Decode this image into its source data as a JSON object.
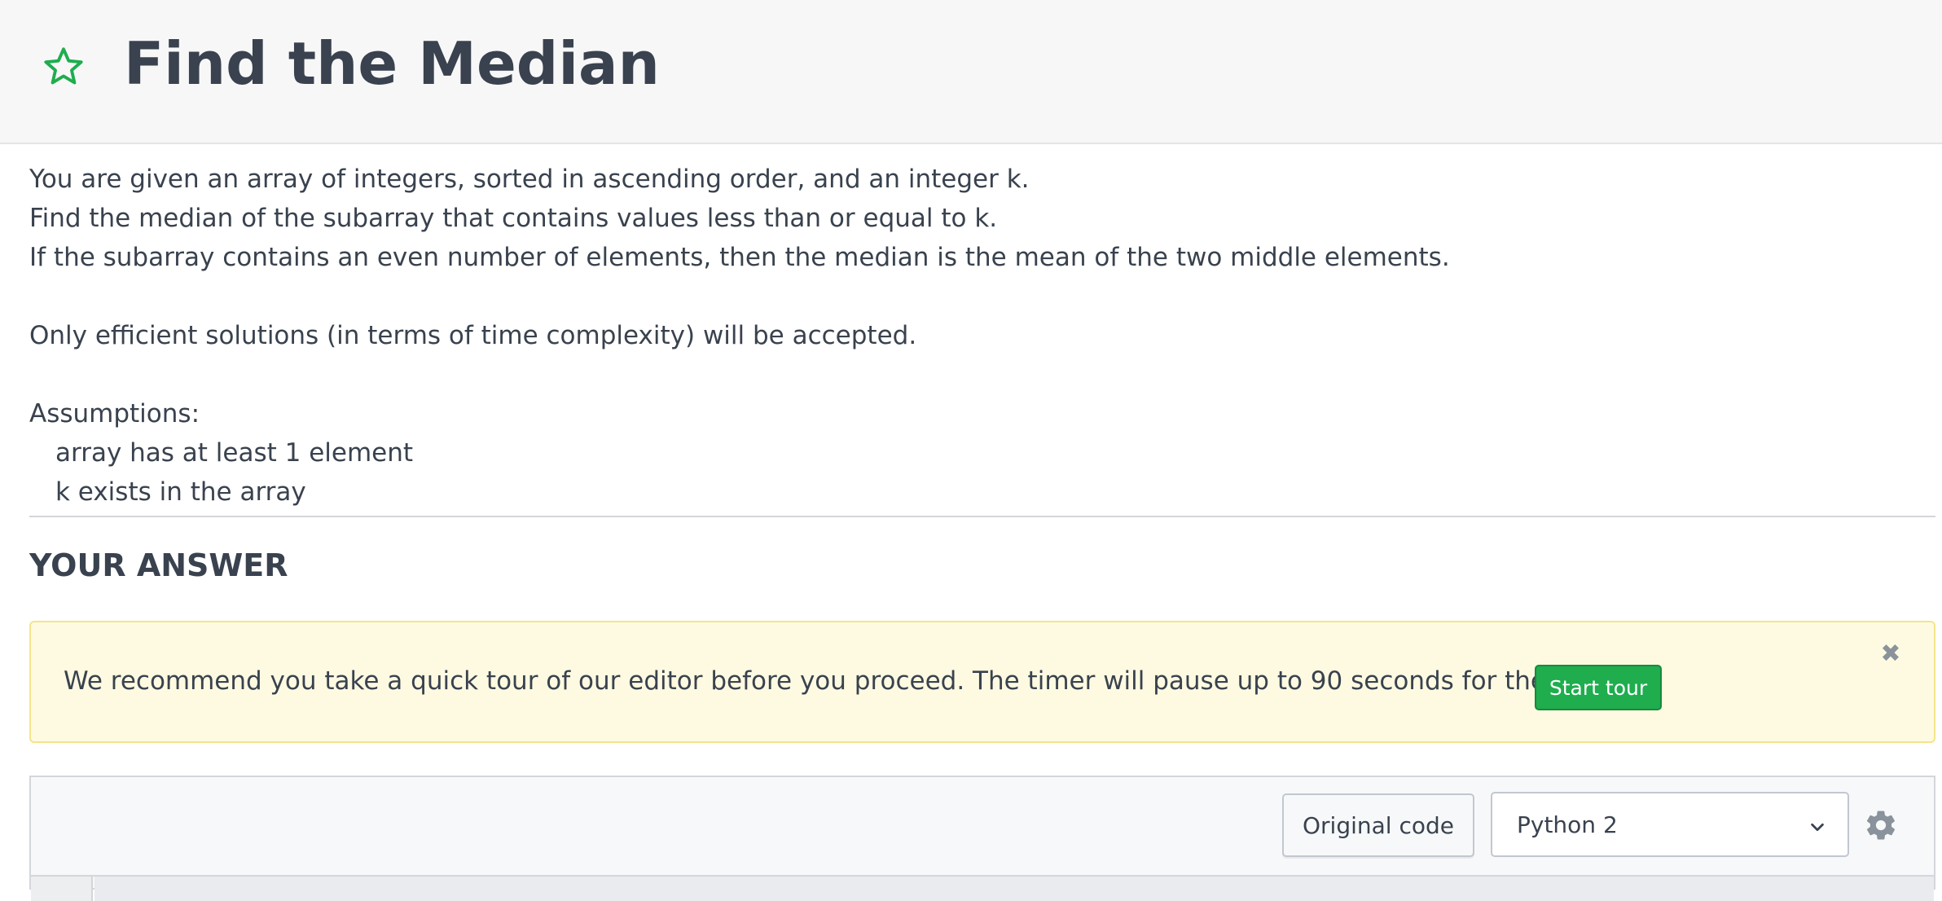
{
  "header": {
    "title": "Find the Median",
    "star_icon": "star-outline-icon",
    "star_color": "#1fad4e"
  },
  "problem": {
    "lines": [
      "You are given an array of integers, sorted in ascending order, and an integer k.",
      "Find the median of the subarray that contains values less than or equal to k.",
      "If the subarray contains an even number of elements, then the median is the mean of the two middle elements."
    ],
    "efficiency_note": "Only efficient solutions (in terms of time complexity) will be accepted.",
    "assumptions_heading": "Assumptions:",
    "assumptions": [
      "array has at least 1 element",
      "k exists in the array"
    ]
  },
  "answer": {
    "heading": "YOUR ANSWER"
  },
  "tour_banner": {
    "message": "We recommend you take a quick tour of our editor before you proceed. The timer will pause up to 90 seconds for the tour.",
    "start_label": "Start tour",
    "close_icon": "close-icon",
    "background": "#fefae1",
    "button_color": "#1fad4e"
  },
  "editor": {
    "original_code_label": "Original code",
    "language": "Python 2",
    "language_chevron_icon": "chevron-down-icon",
    "settings_icon": "gear-icon"
  }
}
